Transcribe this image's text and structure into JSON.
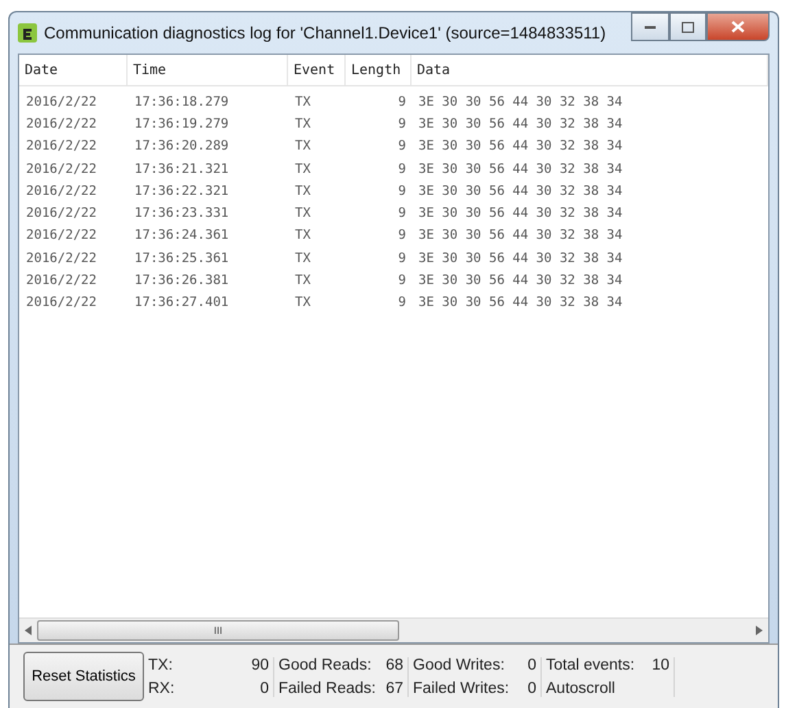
{
  "window": {
    "title": "Communication diagnostics log for 'Channel1.Device1' (source=1484833511)"
  },
  "table": {
    "columns": [
      "Date",
      "Time",
      "Event",
      "Length",
      "Data"
    ],
    "rows": [
      [
        "2016/2/22",
        "17:36:18.279",
        "TX",
        "9",
        "3E 30 30 56 44 30 32 38 34"
      ],
      [
        "2016/2/22",
        "17:36:19.279",
        "TX",
        "9",
        "3E 30 30 56 44 30 32 38 34"
      ],
      [
        "2016/2/22",
        "17:36:20.289",
        "TX",
        "9",
        "3E 30 30 56 44 30 32 38 34"
      ],
      [
        "2016/2/22",
        "17:36:21.321",
        "TX",
        "9",
        "3E 30 30 56 44 30 32 38 34"
      ],
      [
        "2016/2/22",
        "17:36:22.321",
        "TX",
        "9",
        "3E 30 30 56 44 30 32 38 34"
      ],
      [
        "2016/2/22",
        "17:36:23.331",
        "TX",
        "9",
        "3E 30 30 56 44 30 32 38 34"
      ],
      [
        "2016/2/22",
        "17:36:24.361",
        "TX",
        "9",
        "3E 30 30 56 44 30 32 38 34"
      ],
      [
        "2016/2/22",
        "17:36:25.361",
        "TX",
        "9",
        "3E 30 30 56 44 30 32 38 34"
      ],
      [
        "2016/2/22",
        "17:36:26.381",
        "TX",
        "9",
        "3E 30 30 56 44 30 32 38 34"
      ],
      [
        "2016/2/22",
        "17:36:27.401",
        "TX",
        "9",
        "3E 30 30 56 44 30 32 38 34"
      ]
    ]
  },
  "scroll_button": "III",
  "reset_button": "Reset Statistics",
  "stat_groups": [
    [
      {
        "label": "TX:",
        "value": "90"
      },
      {
        "label": "RX:",
        "value": "0"
      }
    ],
    [
      {
        "label": "Good Reads:",
        "value": "68"
      },
      {
        "label": "Failed Reads:",
        "value": "67"
      }
    ],
    [
      {
        "label": "Good Writes:",
        "value": "0"
      },
      {
        "label": "Failed Writes:",
        "value": "0"
      }
    ],
    [
      {
        "label": "Total events:",
        "value": "10"
      },
      {
        "label": "Autoscroll"
      }
    ]
  ]
}
